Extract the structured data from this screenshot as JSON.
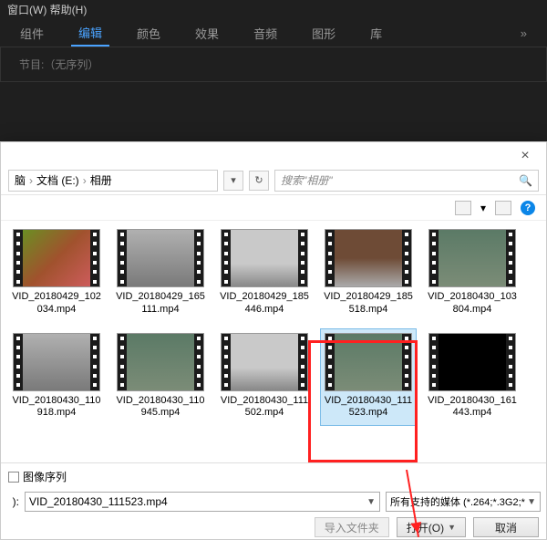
{
  "app": {
    "menubar": "窗口(W)   帮助(H)",
    "tabs": [
      "组件",
      "编辑",
      "颜色",
      "效果",
      "音频",
      "图形",
      "库"
    ],
    "active_tab": 1,
    "panel_hint": "节目:（无序列）"
  },
  "dialog": {
    "close": "×",
    "breadcrumb": {
      "parts": [
        "脑",
        "文档 (E:)",
        "相册"
      ]
    },
    "refresh": "↻",
    "dropdown": "▾",
    "search_placeholder": "搜索\"相册\"",
    "toolbar": {
      "view_icon": "▥",
      "layout_icon": "▤",
      "help": "?"
    },
    "files": [
      {
        "name": "VID_20180429_102034.mp4",
        "colorClass": "cap1"
      },
      {
        "name": "VID_20180429_165111.mp4",
        "colorClass": "cap2"
      },
      {
        "name": "VID_20180429_185446.mp4",
        "colorClass": "cap3"
      },
      {
        "name": "VID_20180429_185518.mp4",
        "colorClass": "cap4"
      },
      {
        "name": "VID_20180430_103804.mp4",
        "colorClass": "cap5"
      },
      {
        "name": "VID_20180430_110918.mp4",
        "colorClass": "cap2"
      },
      {
        "name": "VID_20180430_110945.mp4",
        "colorClass": "cap5"
      },
      {
        "name": "VID_20180430_111502.mp4",
        "colorClass": "cap3"
      },
      {
        "name": "VID_20180430_111523.mp4",
        "colorClass": "cap5",
        "selected": true
      },
      {
        "name": "VID_20180430_161443.mp4",
        "colorClass": "cap6"
      }
    ],
    "image_sequence_label": "图像序列",
    "filename_label": "):",
    "filename_value": "VID_20180430_111523.mp4",
    "filter_label": "所有支持的媒体 (*.264;*.3G2;*",
    "import_folder_btn": "导入文件夹",
    "open_btn": "打开(O)",
    "cancel_btn": "取消"
  }
}
